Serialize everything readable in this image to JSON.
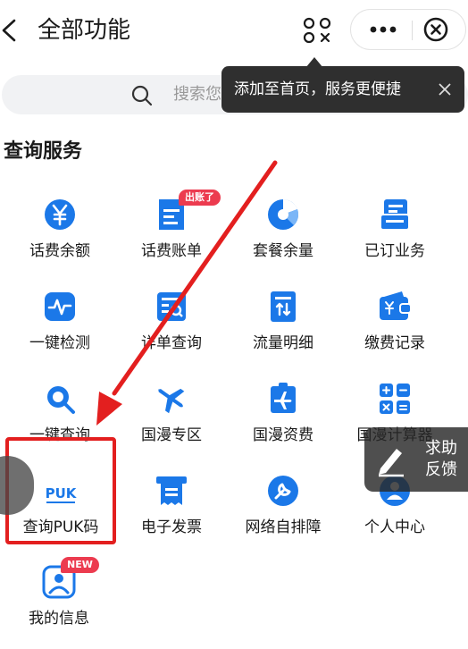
{
  "header": {
    "title": "全部功能"
  },
  "search": {
    "placeholder": "搜索您"
  },
  "tooltip": {
    "text": "添加至首页，服务更便捷"
  },
  "section": {
    "title": "查询服务"
  },
  "items": [
    {
      "label": "话费余额",
      "icon": "yuan-coin-icon"
    },
    {
      "label": "话费账单",
      "icon": "bill-icon",
      "badge": "出账了"
    },
    {
      "label": "套餐余量",
      "icon": "pie-chart-icon"
    },
    {
      "label": "已订业务",
      "icon": "subscription-icon"
    },
    {
      "label": "一键检测",
      "icon": "pulse-icon"
    },
    {
      "label": "详单查询",
      "icon": "detail-list-icon"
    },
    {
      "label": "流量明细",
      "icon": "data-usage-icon"
    },
    {
      "label": "缴费记录",
      "icon": "wallet-icon"
    },
    {
      "label": "一键查询",
      "icon": "search-icon"
    },
    {
      "label": "国漫专区",
      "icon": "airplane-icon"
    },
    {
      "label": "国漫资费",
      "icon": "roaming-fee-icon"
    },
    {
      "label": "国漫计算器",
      "icon": "calculator-icon"
    },
    {
      "label": "查询PUK码",
      "icon": "puk-icon",
      "icon_text": "PUK"
    },
    {
      "label": "电子发票",
      "icon": "invoice-icon"
    },
    {
      "label": "网络自排障",
      "icon": "wrench-icon"
    },
    {
      "label": "个人中心",
      "icon": "person-icon"
    },
    {
      "label": "我的信息",
      "icon": "user-info-icon",
      "badge": "NEW"
    }
  ],
  "floating": {
    "help_text": "求助\n反馈"
  },
  "colors": {
    "icon_blue": "#1b78e8",
    "highlight_red": "#e31f1f",
    "badge_red": "#ec3b4f",
    "tooltip_bg": "#2f2f2f"
  }
}
